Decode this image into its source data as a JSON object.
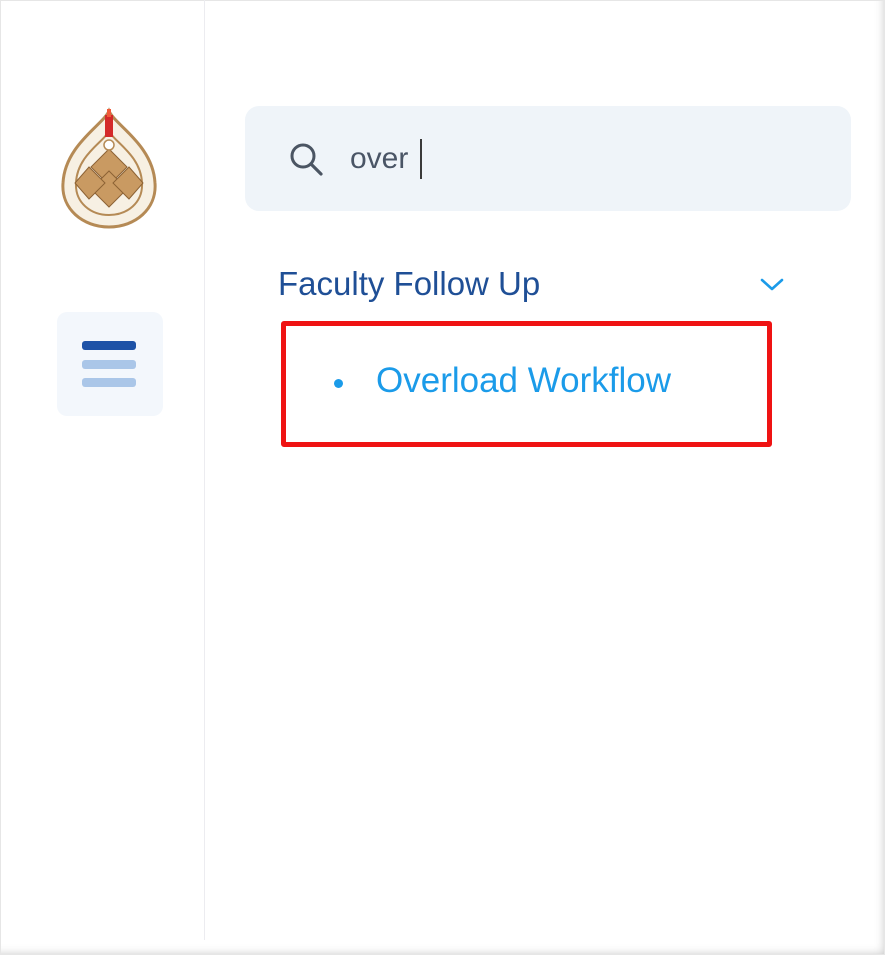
{
  "sidebar": {
    "logo_icon": "university-seal-icon",
    "menu_icon": "hamburger-menu-icon"
  },
  "search": {
    "icon": "search-icon",
    "value": "over",
    "placeholder": ""
  },
  "menu": {
    "group": {
      "title": "Faculty Follow Up",
      "chevron_icon": "chevron-down-icon",
      "expanded": true
    },
    "items": [
      {
        "label": "Overload Workflow",
        "highlighted": true
      }
    ]
  },
  "colors": {
    "group_title": "#1f4f96",
    "item_text": "#1b9be9",
    "highlight_border": "#ef1313",
    "search_bg": "#eff4f9",
    "menu_button_bg": "#f3f7fc",
    "menu_bar_dark": "#1d52a7",
    "menu_bar_light": "#aac6e8"
  }
}
